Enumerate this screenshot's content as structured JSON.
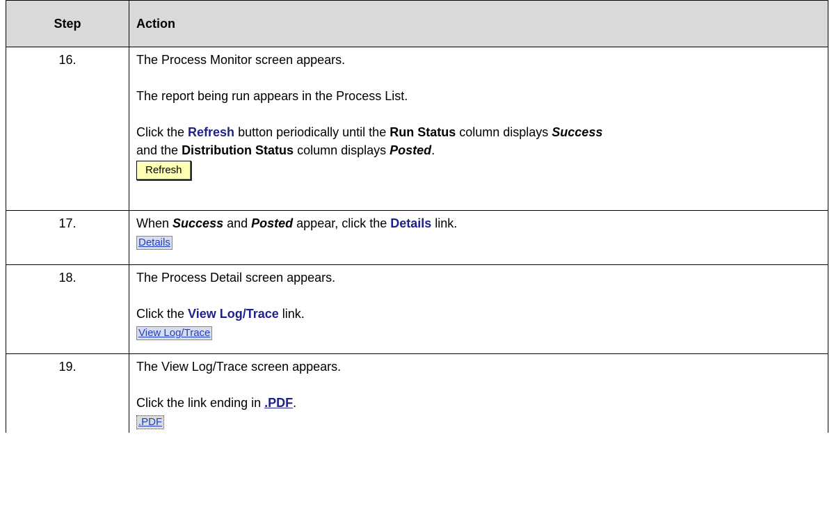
{
  "table": {
    "headers": {
      "step": "Step",
      "action": "Action"
    },
    "rows": [
      {
        "step": "16.",
        "line1": "The Process Monitor screen appears.",
        "line2": "The report being run appears in the Process List.",
        "p3": {
          "t1": "Click the ",
          "refresh": "Refresh",
          "t2": " button periodically until the ",
          "run_status": "Run Status",
          "t3": " column displays ",
          "success": "Success",
          "t4": "and the ",
          "dist_status": "Distribution Status",
          "t5": " column displays ",
          "posted": "Posted",
          "t6": "."
        },
        "button_label": "Refresh"
      },
      {
        "step": "17.",
        "p1": {
          "t1": "When ",
          "success": "Success",
          "t2": " and ",
          "posted": "Posted",
          "t3": " appear, click the ",
          "details": "Details",
          "t4": " link."
        },
        "link_label": "Details"
      },
      {
        "step": "18.",
        "line1": "The Process Detail screen appears.",
        "p2": {
          "t1": "Click the ",
          "viewlog": "View Log/Trace",
          "t2": " link."
        },
        "link_label": "View Log/Trace"
      },
      {
        "step": "19.",
        "line1": "The View Log/Trace screen appears.",
        "p2": {
          "t1": "Click the link ending in ",
          "pdf": ".PDF",
          "t2": "."
        },
        "link_label": ".PDF"
      }
    ]
  }
}
